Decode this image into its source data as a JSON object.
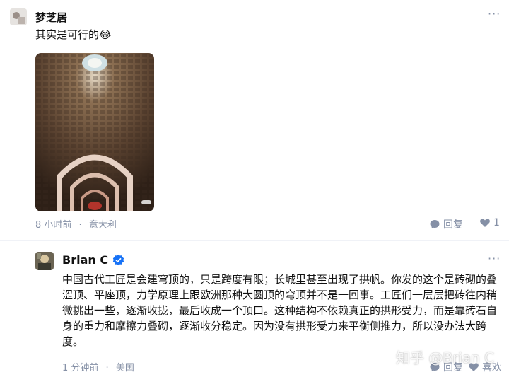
{
  "comments": [
    {
      "author": "梦芝居",
      "text": "其实是可行的",
      "emoji": "😂",
      "time": "8 小时前",
      "location": "意大利",
      "reply_label": "回复",
      "like_count": "1"
    },
    {
      "author": "Brian C",
      "verified": true,
      "text": "中国古代工匠是会建穹顶的，只是跨度有限；长城里甚至出现了拱帆。你发的这个是砖砌的叠涩顶、平座顶，力学原理上跟欧洲那种大圆顶的穹顶并不是一回事。工匠们一层层把砖往内稍微挑出一些，逐渐收拢，最后收成一个顶口。这种结构不依赖真正的拱形受力，而是靠砖石自身的重力和摩擦力叠砌，逐渐收分稳定。因为没有拱形受力来平衡侧推力，所以没办法大跨度。",
      "time": "1 分钟前",
      "location": "美国",
      "reply_label": "回复",
      "like_label": "喜欢"
    }
  ],
  "separator": "·",
  "more": "···",
  "watermark": "知乎 @Brian C",
  "colors": {
    "accent": "#1772f6",
    "meta": "#8590a6"
  }
}
